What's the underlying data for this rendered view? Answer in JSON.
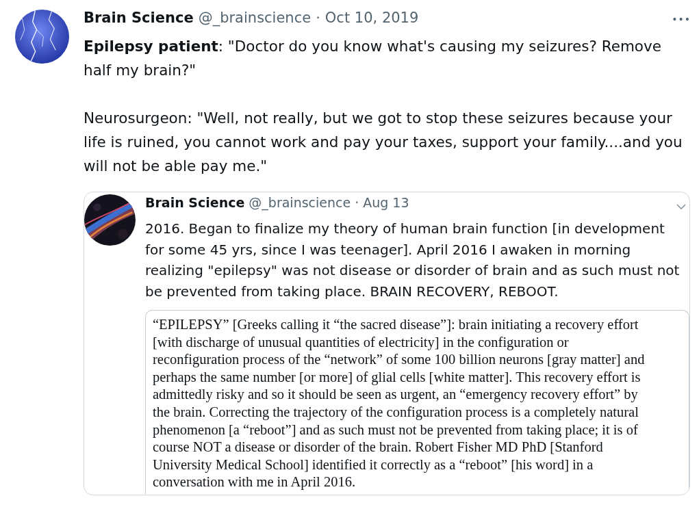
{
  "tweet": {
    "author": "Brain Science",
    "handle": "@_brainscience",
    "separator": "·",
    "date": "Oct 10, 2019",
    "more": "•••",
    "paragraphs": [
      "**Epilepsy patient**: \"Doctor do you know what's causing my seizures? Remove half my brain?\"",
      "Neurosurgeon: \"Well, not really, but we got to stop these seizures because your life is ruined, you cannot work and pay your taxes, support your family....and you will not be able pay me.\""
    ]
  },
  "quoted": {
    "author": "Brain Science",
    "handle": "@_brainscience",
    "separator": "·",
    "date": "Aug 13",
    "text": "2016. Began to finalize my theory of human brain function [in development for some 45 yrs, since I was teenager]. April 2016 I awaken in morning realizing \"epilepsy\" was not disease or disorder of brain and as such must not be prevented from taking place. BRAIN RECOVERY, REBOOT.",
    "document_lines": [
      "“EPILEPSY” [Greeks calling it “the sacred disease”]: brain initiating a recovery effort",
      "[with discharge of unusual quantities of electricity] in the configuration or",
      "reconfiguration process of the “network” of some 100 billion neurons [gray matter] and",
      "perhaps the same number [or more] of glial cells [white matter]. This recovery effort is",
      "admittedly risky and so it should be seen as urgent, an “emergency recovery effort” by",
      "the brain. Correcting the trajectory of the configuration process is a completely natural",
      "phenomenon [a “reboot”] and as such must not be prevented from taking place; it is of",
      "course NOT a disease or disorder of the brain. Robert Fisher MD PhD [Stanford",
      "University Medical School] identified it correctly as a “reboot” [his word] in a",
      "conversation with me in April 2016."
    ]
  }
}
